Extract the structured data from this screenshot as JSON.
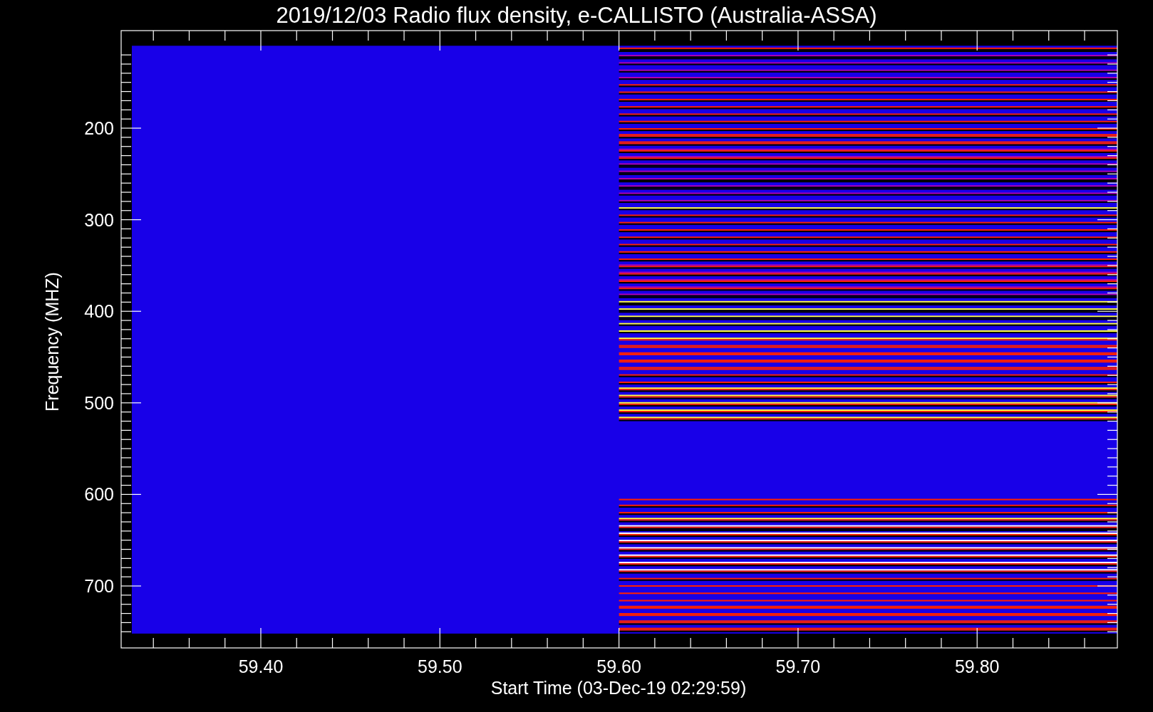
{
  "title": "2019/12/03  Radio flux density, e-CALLISTO (Australia-ASSA)",
  "xlabel": "Start Time (03-Dec-19 02:29:59)",
  "ylabel": "Frequency (MHZ)",
  "xticks": [
    {
      "label": "59.40"
    },
    {
      "label": "59.50"
    },
    {
      "label": "59.60"
    },
    {
      "label": "59.70"
    },
    {
      "label": "59.80"
    }
  ],
  "yticks": [
    {
      "label": "200"
    },
    {
      "label": "300"
    },
    {
      "label": "400"
    },
    {
      "label": "500"
    },
    {
      "label": "600"
    },
    {
      "label": "700"
    }
  ]
}
